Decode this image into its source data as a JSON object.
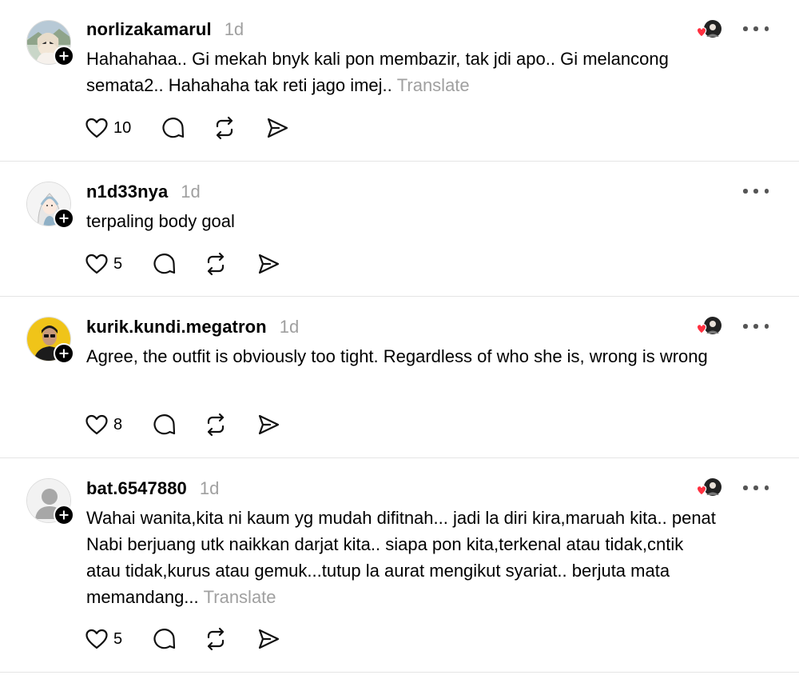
{
  "posts": [
    {
      "username": "norlizakamarul",
      "time": "1d",
      "text": "Hahahahaa.. Gi mekah bnyk kali pon membazir, tak jdi apo.. Gi melancong semata2.. Hahahaha tak reti jago imej..",
      "translate": "Translate",
      "likes": "10",
      "avatar_style": "photo-woman-pastel",
      "has_reactions": true
    },
    {
      "username": "n1d33nya",
      "time": "1d",
      "text": "terpaling body goal",
      "translate": "",
      "likes": "5",
      "avatar_style": "illustration-hijab",
      "has_reactions": false
    },
    {
      "username": "kurik.kundi.megatron",
      "time": "1d",
      "text": "Agree, the outfit is obviously too tight. Regardless of who she is, wrong is wrong",
      "translate": "",
      "likes": "8",
      "avatar_style": "photo-man-yellow",
      "has_reactions": true
    },
    {
      "username": "bat.6547880",
      "time": "1d",
      "text": "Wahai wanita,kita ni kaum yg mudah difitnah... jadi la diri kira,maruah kita.. penat Nabi berjuang utk naikkan darjat kita.. siapa pon kita,terkenal atau tidak,cntik atau tidak,kurus atau gemuk...tutup la aurat mengikut syariat.. berjuta mata memandang...",
      "translate": "Translate",
      "likes": "5",
      "avatar_style": "default-silhouette",
      "has_reactions": true
    }
  ],
  "icons": {
    "like": "heart-icon",
    "reply": "comment-bubble-icon",
    "repost": "repost-icon",
    "share": "send-icon",
    "more": "more-dots-icon",
    "follow": "plus-icon"
  },
  "colors": {
    "muted_text": "#a0a0a0",
    "reaction_heart": "#ff3040",
    "divider": "#e5e5e5"
  }
}
